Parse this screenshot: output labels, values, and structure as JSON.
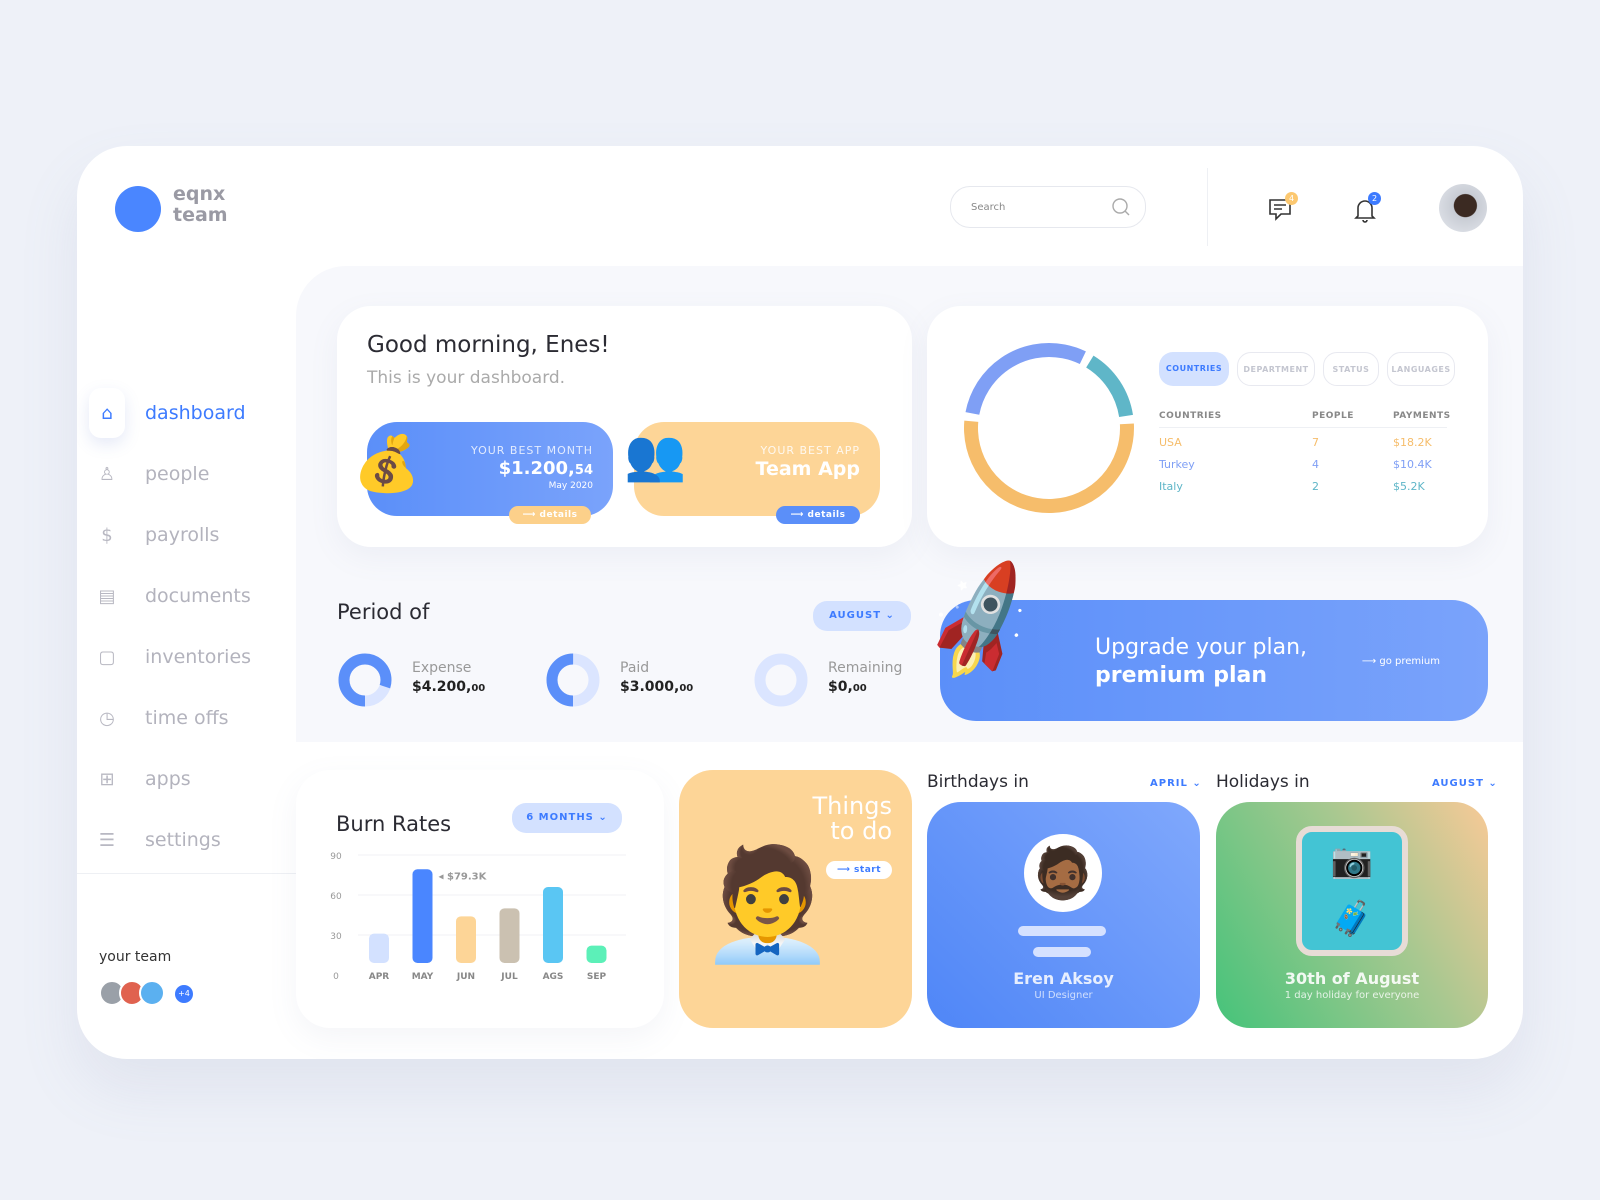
{
  "brand": {
    "line1": "eqnx",
    "line2": "team"
  },
  "header": {
    "search_placeholder": "Search",
    "messages_badge": "4",
    "notifications_badge": "2"
  },
  "sidebar": {
    "items": [
      {
        "label": "dashboard",
        "icon": "home-icon",
        "active": true
      },
      {
        "label": "people",
        "icon": "person-icon"
      },
      {
        "label": "payrolls",
        "icon": "dollar-icon"
      },
      {
        "label": "documents",
        "icon": "document-icon"
      },
      {
        "label": "inventories",
        "icon": "box-icon"
      },
      {
        "label": "time offs",
        "icon": "clock-icon"
      },
      {
        "label": "apps",
        "icon": "grid-icon"
      },
      {
        "label": "settings",
        "icon": "sliders-icon"
      }
    ],
    "team_label": "your team",
    "team_more": "+4"
  },
  "greeting": {
    "title": "Good morning, Enes!",
    "subtitle": "This is your dashboard.",
    "best_month": {
      "label": "YOUR BEST MONTH",
      "value": "$1.200,",
      "cents": "54",
      "date": "May 2020",
      "button": "details"
    },
    "best_app": {
      "label": "YOUR BEST APP",
      "value": "Team App",
      "button": "details"
    }
  },
  "countries": {
    "tabs": [
      "COUNTRIES",
      "DEPARTMENT",
      "STATUS",
      "LANGUAGES"
    ],
    "active_tab": 0,
    "headers": [
      "COUNTRIES",
      "PEOPLE",
      "PAYMENTS"
    ],
    "rows": [
      {
        "country": "USA",
        "people": "7",
        "payment": "$18.2K",
        "amount": 18.2,
        "color": "#f6bd6b"
      },
      {
        "country": "Turkey",
        "people": "4",
        "payment": "$10.4K",
        "amount": 10.4,
        "color": "#7f9ff5"
      },
      {
        "country": "Italy",
        "people": "2",
        "payment": "$5.2K",
        "amount": 5.2,
        "color": "#5fb6c8"
      }
    ]
  },
  "period": {
    "title": "Period of",
    "month": "AUGUST",
    "items": [
      {
        "label": "Expense",
        "value": "$4.200,",
        "cents": "00",
        "fill": 0.8
      },
      {
        "label": "Paid",
        "value": "$3.000,",
        "cents": "00",
        "fill": 0.5
      },
      {
        "label": "Remaining",
        "value": "$0,",
        "cents": "00",
        "fill": 0
      }
    ]
  },
  "upgrade": {
    "line1": "Upgrade your plan,",
    "line2": "premium plan",
    "button": "go premium"
  },
  "burn": {
    "title": "Burn Rates",
    "range": "6 MONTHS"
  },
  "chart_data": {
    "type": "bar",
    "title": "Burn Rates",
    "categories": [
      "APR",
      "MAY",
      "JUN",
      "JUL",
      "AGS",
      "SEP"
    ],
    "values": [
      31,
      79.3,
      44,
      50,
      66,
      22
    ],
    "ylim": [
      0,
      90
    ],
    "yticks": [
      0,
      30,
      60,
      90
    ],
    "grid": true,
    "colors": [
      "#d3e1ff",
      "#4a86ff",
      "#fdd597",
      "#cbc1b1",
      "#5ac6f3",
      "#5cf0b8"
    ],
    "annotation": {
      "category": "MAY",
      "text": "$79.3K"
    }
  },
  "todo": {
    "line1": "Things",
    "line2": "to do",
    "button": "start"
  },
  "birthdays": {
    "title": "Birthdays in",
    "month": "APRIL",
    "name": "Eren Aksoy",
    "role": "UI Designer"
  },
  "holidays": {
    "title": "Holidays in",
    "month": "AUGUST",
    "date": "30th of August",
    "note": "1 day holiday for everyone"
  }
}
